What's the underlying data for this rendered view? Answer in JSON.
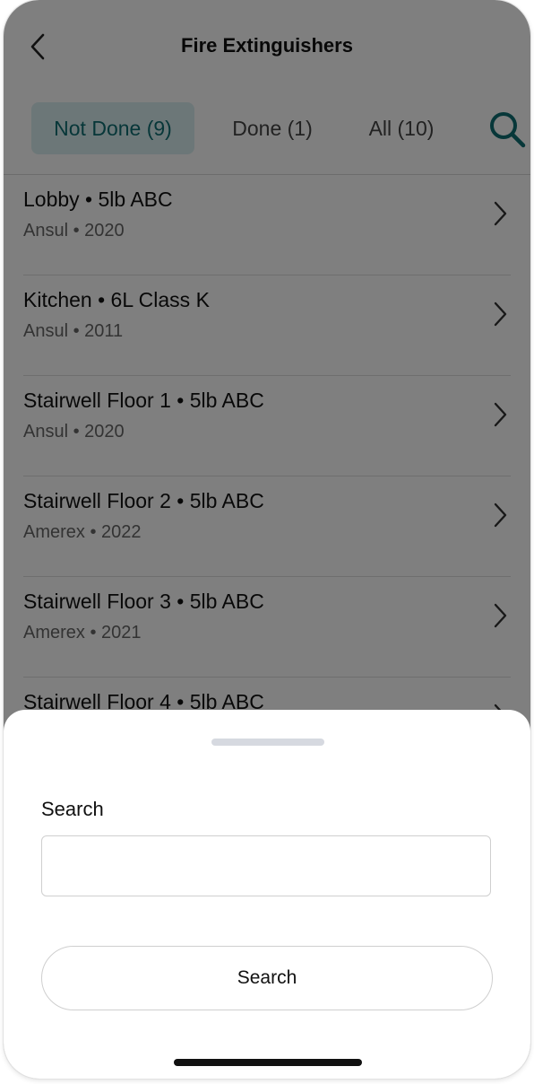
{
  "header": {
    "title": "Fire Extinguishers",
    "back_icon": "chevron-left-icon"
  },
  "tabs": [
    {
      "label": "Not Done (9)",
      "active": true
    },
    {
      "label": "Done (1)",
      "active": false
    },
    {
      "label": "All (10)",
      "active": false
    }
  ],
  "search_icon": "magnifier-icon",
  "colors": {
    "accent": "#0f6e73",
    "active_tab_bg": "#d9eef0",
    "overlay": "rgba(0,0,0,0.5)"
  },
  "items": [
    {
      "title": "Lobby • 5lb ABC",
      "subtitle": "Ansul • 2020"
    },
    {
      "title": "Kitchen • 6L Class K",
      "subtitle": "Ansul • 2011"
    },
    {
      "title": "Stairwell Floor 1 • 5lb ABC",
      "subtitle": "Ansul • 2020"
    },
    {
      "title": "Stairwell Floor 2 • 5lb ABC",
      "subtitle": "Amerex • 2022"
    },
    {
      "title": "Stairwell Floor 3 • 5lb ABC",
      "subtitle": "Amerex • 2021"
    },
    {
      "title": "Stairwell Floor 4 • 5lb ABC",
      "subtitle": ""
    }
  ],
  "sheet": {
    "label": "Search",
    "input_value": "",
    "input_placeholder": "",
    "button_label": "Search"
  }
}
